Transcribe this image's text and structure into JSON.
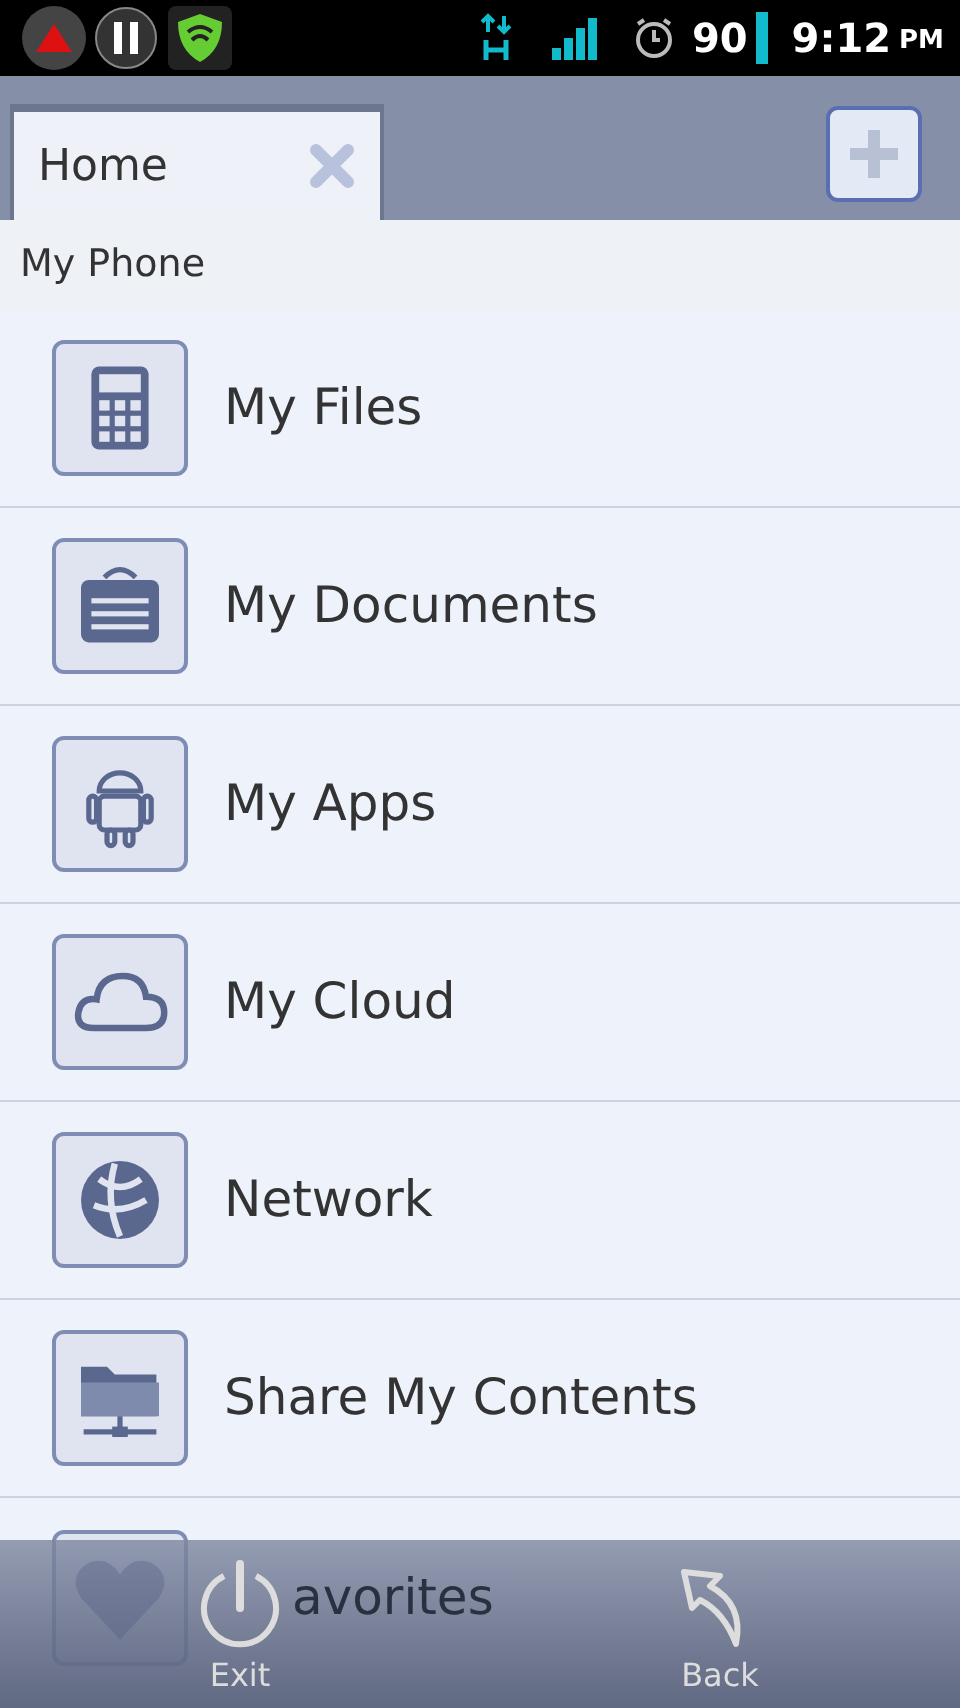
{
  "status_bar": {
    "battery": "90",
    "time": "9:12",
    "ampm": "PM"
  },
  "tabs": [
    {
      "label": "Home",
      "selected": true
    }
  ],
  "location": "My Phone",
  "items": [
    {
      "label": "My Files"
    },
    {
      "label": "My Documents"
    },
    {
      "label": "My Apps"
    },
    {
      "label": "My Cloud"
    },
    {
      "label": "Network"
    },
    {
      "label": "Share My Contents"
    },
    {
      "label": "avorites"
    }
  ],
  "bottom_bar": [
    {
      "label": "Exit"
    },
    {
      "label": "Back"
    }
  ]
}
